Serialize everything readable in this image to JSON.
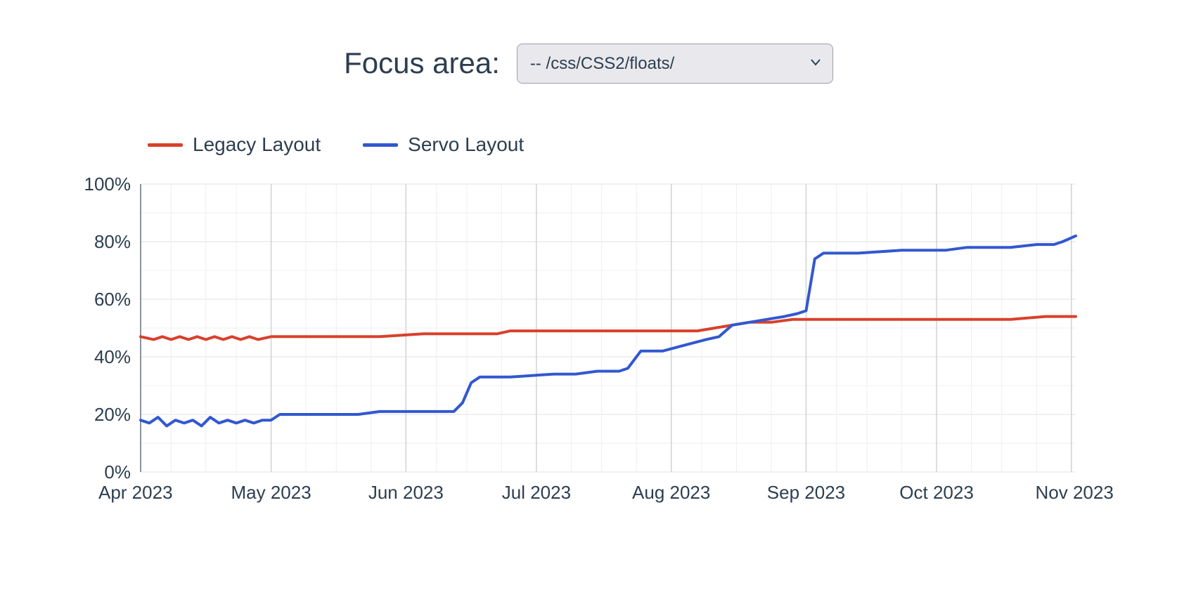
{
  "header": {
    "label": "Focus area:",
    "selected": "-- /css/CSS2/floats/"
  },
  "legend": [
    {
      "name": "Legacy Layout",
      "color": "#d9402b"
    },
    {
      "name": "Servo Layout",
      "color": "#3258d0"
    }
  ],
  "chart_data": {
    "type": "line",
    "ylabel": "",
    "xlabel": "",
    "ylim": [
      0,
      100
    ],
    "y_ticks": [
      0,
      20,
      40,
      60,
      80,
      100
    ],
    "y_tick_labels": [
      "0%",
      "20%",
      "40%",
      "60%",
      "80%",
      "100%"
    ],
    "x_range": [
      0,
      215
    ],
    "x_ticks": [
      0,
      30,
      61,
      91,
      122,
      153,
      183,
      214
    ],
    "x_tick_labels": [
      "Apr 2023",
      "May 2023",
      "Jun 2023",
      "Jul 2023",
      "Aug 2023",
      "Sep 2023",
      "Oct 2023",
      "Nov 2023"
    ],
    "x_minor_ticks": [
      7,
      15,
      22,
      38,
      45,
      53,
      68,
      75,
      83,
      99,
      106,
      114,
      129,
      137,
      145,
      160,
      167,
      175,
      191,
      198,
      206
    ],
    "series": [
      {
        "name": "Legacy Layout",
        "color": "#d9402b",
        "points": [
          [
            0,
            47
          ],
          [
            3,
            46
          ],
          [
            5,
            47
          ],
          [
            7,
            46
          ],
          [
            9,
            47
          ],
          [
            11,
            46
          ],
          [
            13,
            47
          ],
          [
            15,
            46
          ],
          [
            17,
            47
          ],
          [
            19,
            46
          ],
          [
            21,
            47
          ],
          [
            23,
            46
          ],
          [
            25,
            47
          ],
          [
            27,
            46
          ],
          [
            30,
            47
          ],
          [
            35,
            47
          ],
          [
            45,
            47
          ],
          [
            55,
            47
          ],
          [
            65,
            48
          ],
          [
            75,
            48
          ],
          [
            82,
            48
          ],
          [
            85,
            49
          ],
          [
            90,
            49
          ],
          [
            100,
            49
          ],
          [
            110,
            49
          ],
          [
            120,
            49
          ],
          [
            128,
            49
          ],
          [
            132,
            50
          ],
          [
            140,
            52
          ],
          [
            145,
            52
          ],
          [
            150,
            53
          ],
          [
            160,
            53
          ],
          [
            170,
            53
          ],
          [
            180,
            53
          ],
          [
            190,
            53
          ],
          [
            200,
            53
          ],
          [
            208,
            54
          ],
          [
            215,
            54
          ]
        ]
      },
      {
        "name": "Servo Layout",
        "color": "#3258d0",
        "points": [
          [
            0,
            18
          ],
          [
            2,
            17
          ],
          [
            4,
            19
          ],
          [
            6,
            16
          ],
          [
            8,
            18
          ],
          [
            10,
            17
          ],
          [
            12,
            18
          ],
          [
            14,
            16
          ],
          [
            16,
            19
          ],
          [
            18,
            17
          ],
          [
            20,
            18
          ],
          [
            22,
            17
          ],
          [
            24,
            18
          ],
          [
            26,
            17
          ],
          [
            28,
            18
          ],
          [
            30,
            18
          ],
          [
            32,
            20
          ],
          [
            40,
            20
          ],
          [
            50,
            20
          ],
          [
            55,
            21
          ],
          [
            60,
            21
          ],
          [
            65,
            21
          ],
          [
            70,
            21
          ],
          [
            72,
            21
          ],
          [
            74,
            24
          ],
          [
            76,
            31
          ],
          [
            78,
            33
          ],
          [
            85,
            33
          ],
          [
            95,
            34
          ],
          [
            100,
            34
          ],
          [
            105,
            35
          ],
          [
            110,
            35
          ],
          [
            112,
            36
          ],
          [
            115,
            42
          ],
          [
            120,
            42
          ],
          [
            125,
            44
          ],
          [
            130,
            46
          ],
          [
            133,
            47
          ],
          [
            136,
            51
          ],
          [
            140,
            52
          ],
          [
            144,
            53
          ],
          [
            148,
            54
          ],
          [
            151,
            55
          ],
          [
            153,
            56
          ],
          [
            155,
            74
          ],
          [
            157,
            76
          ],
          [
            165,
            76
          ],
          [
            175,
            77
          ],
          [
            185,
            77
          ],
          [
            190,
            78
          ],
          [
            200,
            78
          ],
          [
            206,
            79
          ],
          [
            210,
            79
          ],
          [
            212,
            80
          ],
          [
            215,
            82
          ]
        ]
      }
    ]
  }
}
